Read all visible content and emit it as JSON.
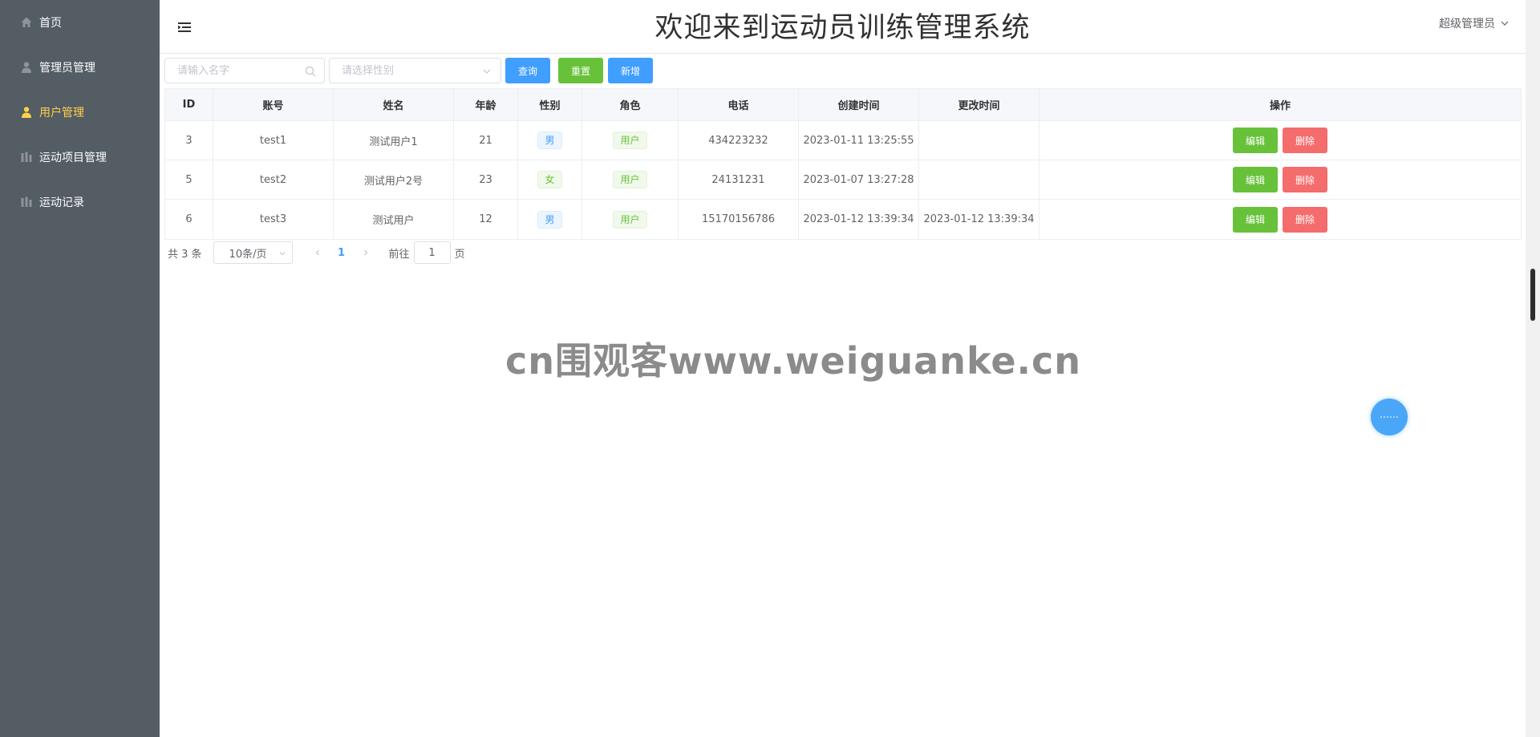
{
  "sidebar": {
    "items": [
      {
        "label": "首页",
        "icon": "home-icon"
      },
      {
        "label": "管理员管理",
        "icon": "user-icon"
      },
      {
        "label": "用户管理",
        "icon": "user-icon"
      },
      {
        "label": "运动项目管理",
        "icon": "chart-icon"
      },
      {
        "label": "运动记录",
        "icon": "chart-icon"
      }
    ],
    "active_index": 2,
    "background": "#545c64",
    "active_color": "#ffd04b"
  },
  "header": {
    "title": "欢迎来到运动员训练管理系统",
    "user_label": "超级管理员"
  },
  "toolbar": {
    "name_placeholder": "请输入名字",
    "gender_placeholder": "请选择性别",
    "query_label": "查询",
    "reset_label": "重置",
    "add_label": "新增"
  },
  "table": {
    "columns": [
      "ID",
      "账号",
      "姓名",
      "年龄",
      "性别",
      "角色",
      "电话",
      "创建时间",
      "更改时间",
      "操作"
    ],
    "rows": [
      {
        "id": "3",
        "account": "test1",
        "name": "测试用户1",
        "age": "21",
        "gender": "男",
        "role": "用户",
        "phone": "434223232",
        "created": "2023-01-11 13:25:55",
        "updated": ""
      },
      {
        "id": "5",
        "account": "test2",
        "name": "测试用户2号",
        "age": "23",
        "gender": "女",
        "role": "用户",
        "phone": "24131231",
        "created": "2023-01-07 13:27:28",
        "updated": ""
      },
      {
        "id": "6",
        "account": "test3",
        "name": "测试用户",
        "age": "12",
        "gender": "男",
        "role": "用户",
        "phone": "15170156786",
        "created": "2023-01-12 13:39:34",
        "updated": "2023-01-12 13:39:34"
      }
    ],
    "edit_label": "编辑",
    "delete_label": "删除"
  },
  "pagination": {
    "total_label": "共 3 条",
    "page_size": "10条/页",
    "current_page": "1",
    "goto_prefix": "前往",
    "goto_value": "1",
    "goto_suffix": "页"
  },
  "watermark": "cn围观客www.weiguanke.cn",
  "colors": {
    "primary": "#409eff",
    "success": "#67c23a",
    "danger": "#f56c6c"
  }
}
